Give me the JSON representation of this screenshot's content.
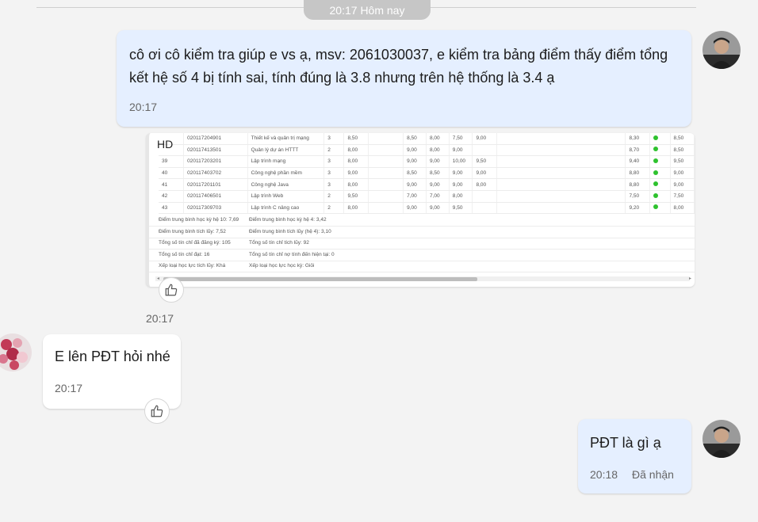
{
  "date_header": "20:17 Hôm nay",
  "messages": [
    {
      "text": "cô ơi cô kiểm tra giúp e vs ạ, msv: 2061030037, e kiểm tra bảng điểm thấy điểm tổng kết hệ số 4 bị tính sai, tính đúng là 3.8 nhưng trên hệ thống là 3.4 ạ",
      "time": "20:17"
    },
    {
      "image_label": "HD",
      "time": "20:17"
    },
    {
      "text": "E lên PĐT hỏi nhé",
      "time": "20:17"
    },
    {
      "text": "PĐT là gì ạ",
      "time": "20:18",
      "status": "Đã nhận"
    }
  ],
  "grade_rows": [
    {
      "stt": "",
      "code": "020117204901",
      "name": "Thiết kế và quản trị mạng",
      "credits": "3",
      "s1": "8,50",
      "s2": "8,50",
      "s3": "8,00",
      "s4": "7,50",
      "s5": "9,00",
      "total": "8,30",
      "final": "8,50"
    },
    {
      "stt": "",
      "code": "020117413501",
      "name": "Quản lý dự án HTTT",
      "credits": "2",
      "s1": "8,00",
      "s2": "9,00",
      "s3": "8,00",
      "s4": "9,00",
      "s5": "",
      "total": "8,70",
      "final": "8,50"
    },
    {
      "stt": "39",
      "code": "020117203201",
      "name": "Lập trình mạng",
      "credits": "3",
      "s1": "8,00",
      "s2": "9,00",
      "s3": "9,00",
      "s4": "10,00",
      "s5": "9,50",
      "total": "9,40",
      "final": "9,50"
    },
    {
      "stt": "40",
      "code": "020117403702",
      "name": "Công nghệ phần mềm",
      "credits": "3",
      "s1": "9,00",
      "s2": "8,50",
      "s3": "8,50",
      "s4": "9,00",
      "s5": "9,00",
      "total": "8,80",
      "final": "9,00"
    },
    {
      "stt": "41",
      "code": "020117201101",
      "name": "Công nghệ Java",
      "credits": "3",
      "s1": "8,00",
      "s2": "9,00",
      "s3": "9,00",
      "s4": "9,00",
      "s5": "8,00",
      "total": "8,80",
      "final": "9,00"
    },
    {
      "stt": "42",
      "code": "020117406501",
      "name": "Lập trình Web",
      "credits": "2",
      "s1": "9,50",
      "s2": "7,00",
      "s3": "7,00",
      "s4": "8,00",
      "s5": "",
      "total": "7,50",
      "final": "7,50"
    },
    {
      "stt": "43",
      "code": "020117309703",
      "name": "Lập trình C nâng cao",
      "credits": "2",
      "s1": "8,00",
      "s2": "9,00",
      "s3": "9,00",
      "s4": "9,50",
      "s5": "",
      "total": "9,20",
      "final": "8,00"
    }
  ],
  "summary_rows": [
    {
      "left": "Điểm trung bình học kỳ hệ 10: 7,69",
      "right": "Điểm trung bình học kỳ hệ 4: 3,42"
    },
    {
      "left": "Điểm trung bình tích lũy: 7,52",
      "right": "Điểm trung bình tích lũy (hệ 4): 3,10"
    },
    {
      "left": "Tổng số tín chỉ đã đăng ký: 105",
      "right": "Tổng số tín chỉ tích lũy: 92"
    },
    {
      "left": "Tổng số tín chỉ đạt: 16",
      "right": "Tổng số tín chỉ nợ tính đến hiện tại: 0"
    },
    {
      "left": "Xếp loại học lực tích lũy: Khá",
      "right": "Xếp loại học lực học kỳ: Giỏi"
    }
  ],
  "colors": {
    "my_bubble": "#e5efff",
    "their_bubble": "#ffffff",
    "pass_dot": "#2ec22e"
  }
}
